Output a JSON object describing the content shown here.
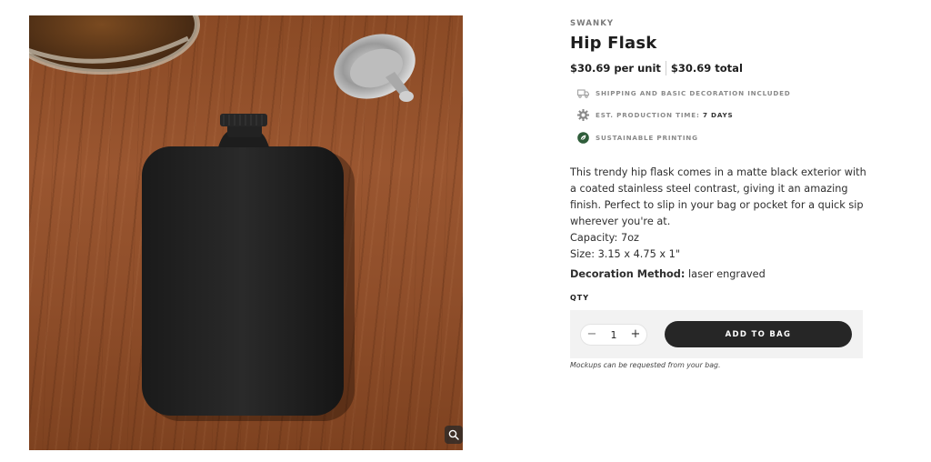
{
  "product": {
    "brand": "SWANKY",
    "title": "Hip Flask",
    "price_unit": "$30.69 per unit",
    "price_total": "$30.69 total",
    "image_icon": "hip-flask-photo"
  },
  "features": [
    {
      "icon": "truck-icon",
      "text": "SHIPPING AND BASIC DECORATION INCLUDED",
      "value": ""
    },
    {
      "icon": "gear-icon",
      "text": "EST. PRODUCTION TIME:",
      "value": "7 DAYS"
    },
    {
      "icon": "leaf-icon",
      "text": "SUSTAINABLE PRINTING",
      "value": "",
      "color": "#2f5d3a"
    }
  ],
  "description": {
    "paragraph": "This trendy hip flask comes in a matte black exterior with a coated stainless steel contrast, giving it an amazing finish. Perfect to slip in your bag or pocket for a quick sip wherever you're at.",
    "capacity": "Capacity: 7oz",
    "size": "Size: 3.15 x 4.75 x 1\""
  },
  "decoration": {
    "label": "Decoration Method:",
    "value": "laser engraved"
  },
  "cart": {
    "qty_label": "QTY",
    "qty_value": "1",
    "minus": "−",
    "plus": "+",
    "add_label": "ADD TO BAG",
    "note": "Mockups can be requested from your bag."
  },
  "colors": {
    "button": "#262626",
    "panel": "#f2f2f2",
    "leaf": "#2f5d3a"
  }
}
